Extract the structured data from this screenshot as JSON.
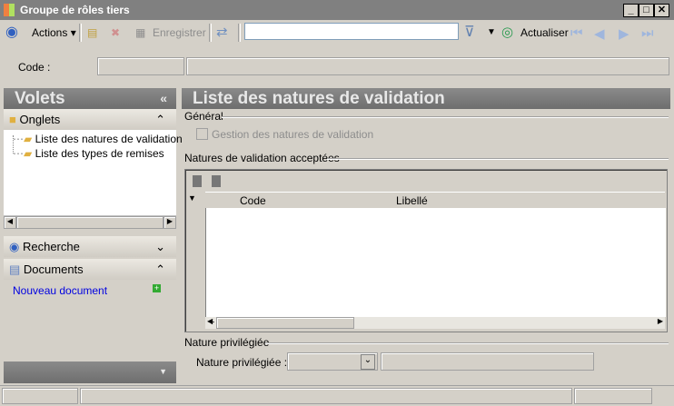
{
  "window": {
    "title": "Groupe de rôles tiers"
  },
  "toolbar": {
    "actions": "Actions",
    "save": "Enregistrer",
    "refresh": "Actualiser",
    "search_value": ""
  },
  "code_row": {
    "label": "Code :",
    "code_value": "",
    "desc_value": ""
  },
  "sidebar": {
    "title": "Volets",
    "onglets": "Onglets",
    "tree": [
      "Liste des natures de validation",
      "Liste des types de remises"
    ],
    "recherche": "Recherche",
    "documents": "Documents",
    "new_document": "Nouveau document"
  },
  "main": {
    "title": "Liste des natures de validation",
    "general": "Général",
    "checkbox_label": "Gestion des natures de validation",
    "accepted_group": "Natures de validation acceptées",
    "columns": [
      "Code",
      "Libellé"
    ],
    "preferred_group": "Nature privilégiée",
    "preferred_label": "Nature privilégiée :",
    "preferred_value": "",
    "preferred_desc": ""
  }
}
